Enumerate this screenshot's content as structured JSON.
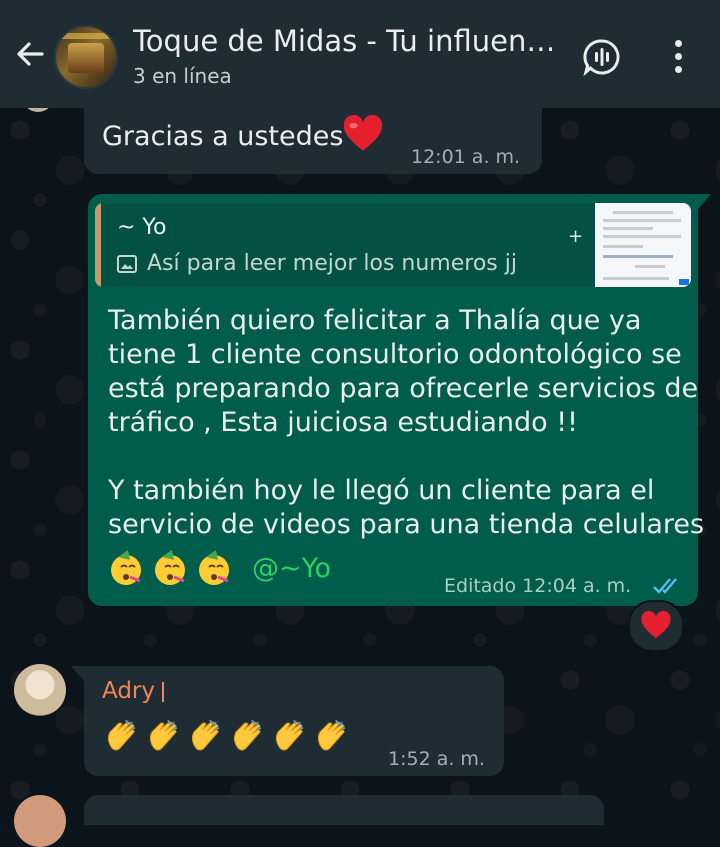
{
  "header": {
    "title": "Toque de Midas - Tu influenc...",
    "subtitle": "3 en línea"
  },
  "messages": [
    {
      "text": "Gracias a ustedes",
      "emoji": "red-heart",
      "time": "12:01 a. m."
    },
    {
      "quote": {
        "name": "~ Yo",
        "text": "Así para leer mejor los numeros jj",
        "thumbnail": "image-thumbnail"
      },
      "paragraph1": [
        "También quiero felicitar a Thalía que ya",
        "tiene 1 cliente consultorio odontológico se",
        "está preparando para ofrecerle servicios de",
        "tráfico , Esta juiciosa estudiando !!"
      ],
      "paragraph2": [
        "Y también hoy le llegó un cliente para el",
        "servicio de videos para una tienda celulares"
      ],
      "emojis": [
        "partying-face",
        "partying-face",
        "partying-face"
      ],
      "mention": "@~Yo",
      "time": "Editado 12:04 a. m.",
      "status": "read-double-check",
      "reaction": "red-heart"
    },
    {
      "sender": "Adry",
      "emojis": [
        "clapping-hands",
        "clapping-hands",
        "clapping-hands",
        "clapping-hands",
        "clapping-hands",
        "clapping-hands"
      ],
      "time": "1:52 a. m."
    }
  ],
  "colors": {
    "header_bg": "#1f2c33",
    "incoming_bubble": "#202c33",
    "outgoing_bubble": "#005c4b",
    "mention": "#25d366",
    "sender_name": "#f0855b",
    "read_ticks": "#53bdeb"
  }
}
